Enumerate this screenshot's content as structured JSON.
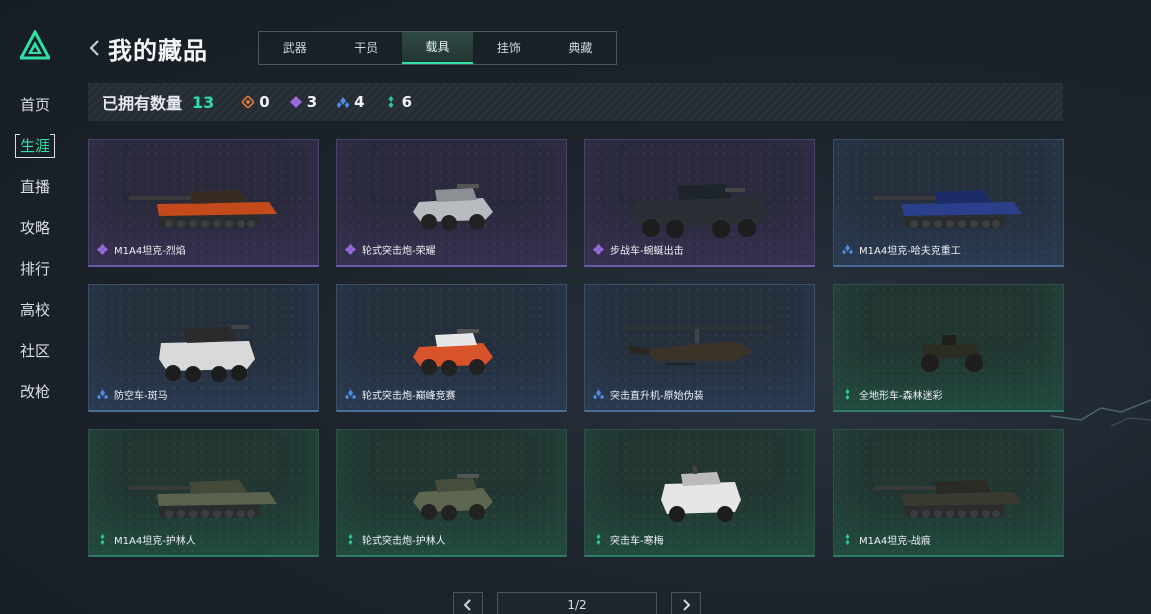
{
  "sidebar": {
    "items": [
      {
        "label": "首页"
      },
      {
        "label": "生涯"
      },
      {
        "label": "直播"
      },
      {
        "label": "攻略"
      },
      {
        "label": "排行"
      },
      {
        "label": "高校"
      },
      {
        "label": "社区"
      },
      {
        "label": "改枪"
      }
    ],
    "active_index": 1
  },
  "header": {
    "title": "我的藏品",
    "tabs": [
      {
        "label": "武器"
      },
      {
        "label": "干员"
      },
      {
        "label": "载具"
      },
      {
        "label": "挂饰"
      },
      {
        "label": "典藏"
      }
    ],
    "active_tab_index": 2
  },
  "summary": {
    "label": "已拥有数量",
    "total": "13",
    "stats": [
      {
        "value": "0",
        "color": "#e07a3a"
      },
      {
        "value": "3",
        "color": "#9a6be0"
      },
      {
        "value": "4",
        "color": "#4f8fe0"
      },
      {
        "value": "6",
        "color": "#2fc894"
      }
    ]
  },
  "cards": [
    {
      "name": "M1A4坦克-烈焰",
      "rarity": "purple",
      "icon": "tank-icon"
    },
    {
      "name": "轮式突击炮-荣耀",
      "rarity": "purple",
      "icon": "armored-car-icon"
    },
    {
      "name": "步战车-蜿蜒出击",
      "rarity": "purple",
      "icon": "ifv-icon"
    },
    {
      "name": "M1A4坦克-哈夫克重工",
      "rarity": "blue",
      "icon": "tank-icon"
    },
    {
      "name": "防空车-斑马",
      "rarity": "blue",
      "icon": "anti-air-vehicle-icon"
    },
    {
      "name": "轮式突击炮-巅峰竞赛",
      "rarity": "blue",
      "icon": "armored-car-icon"
    },
    {
      "name": "突击直升机-原始伪装",
      "rarity": "blue",
      "icon": "helicopter-icon"
    },
    {
      "name": "全地形车-森林迷彩",
      "rarity": "green",
      "icon": "atv-icon"
    },
    {
      "name": "M1A4坦克-护林人",
      "rarity": "green",
      "icon": "tank-icon"
    },
    {
      "name": "轮式突击炮-护林人",
      "rarity": "green",
      "icon": "armored-car-icon"
    },
    {
      "name": "突击车-寒梅",
      "rarity": "green",
      "icon": "assault-vehicle-icon"
    },
    {
      "name": "M1A4坦克-战痕",
      "rarity": "green",
      "icon": "tank-icon"
    }
  ],
  "pagination": {
    "label": "1/2"
  }
}
